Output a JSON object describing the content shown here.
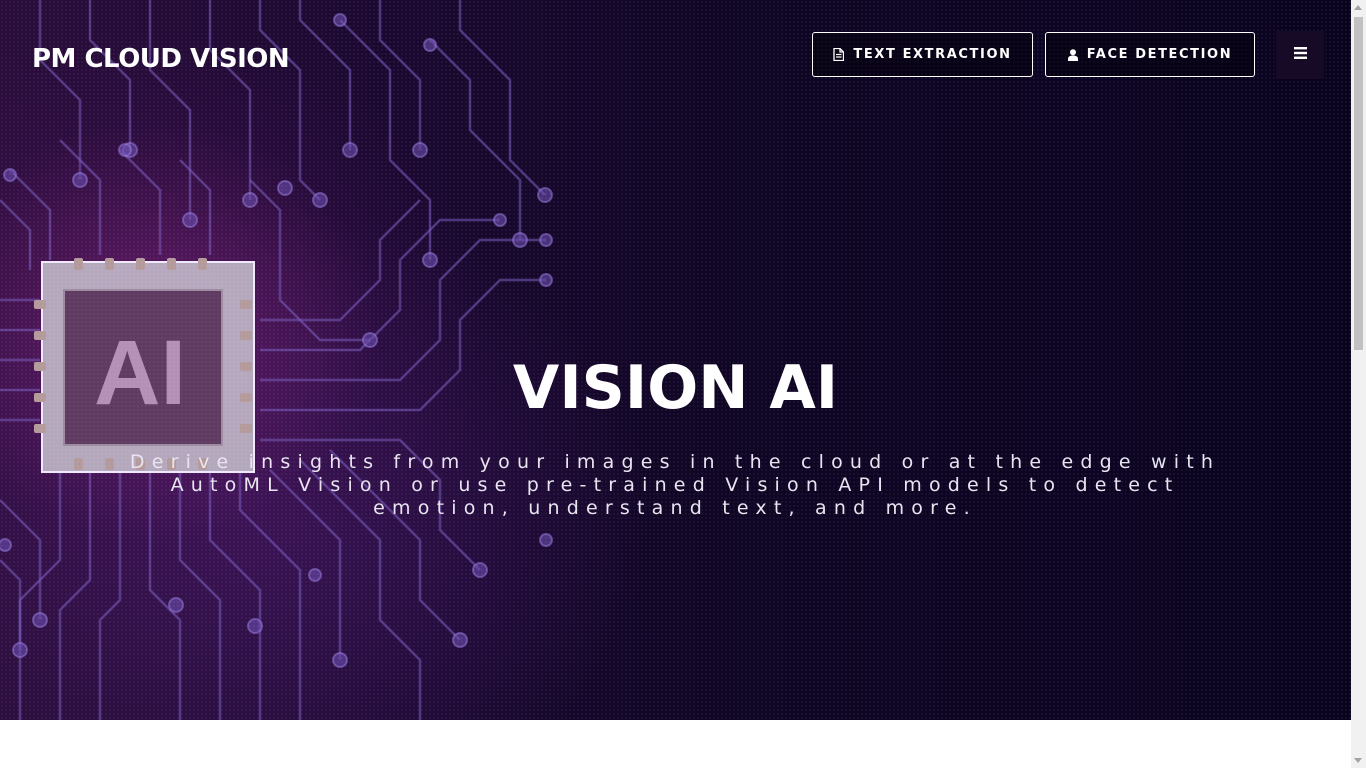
{
  "header": {
    "brand": "PM CLOUD VISION",
    "nav": [
      {
        "label": "TEXT EXTRACTION",
        "icon": "document-icon"
      },
      {
        "label": "FACE DETECTION",
        "icon": "user-icon"
      }
    ],
    "menu_icon": "hamburger-menu-icon"
  },
  "hero": {
    "title": "VISION AI",
    "subtitle": "Derive insights from your images in the cloud or at the edge with AutoML Vision or use pre-trained Vision API models to detect emotion, understand text, and more.",
    "chip_label": "AI"
  },
  "colors": {
    "background_dark": "#0f0524",
    "background_glow": "#96288c",
    "circuit": "#7a5cc0",
    "text": "#ffffff",
    "content_background": "#ffffff"
  }
}
